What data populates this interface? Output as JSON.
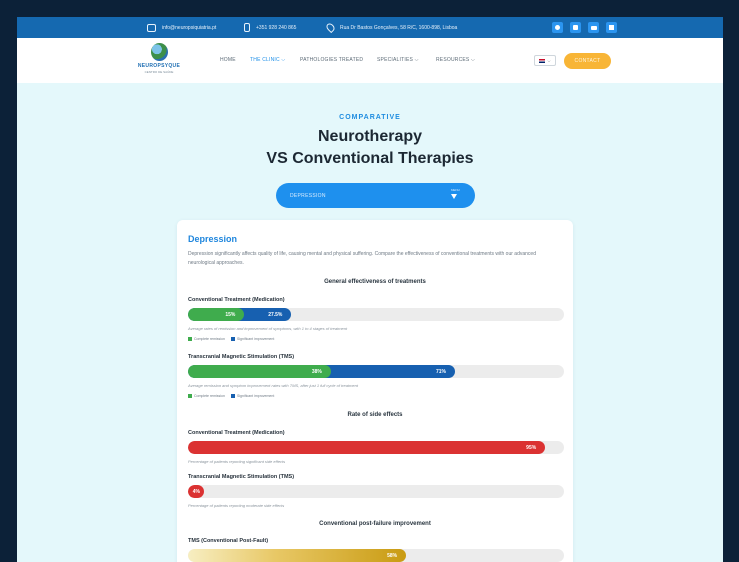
{
  "topbar": {
    "email": "info@neuropsiquiatria.pt",
    "phone": "+351 928 240 865",
    "address": "Rua Dr Bastos Gonçalves, 58 R/C, 1600-898, Lisboa",
    "social_icons": [
      "whatsapp-icon",
      "instagram-icon",
      "youtube-icon",
      "linkedin-icon"
    ]
  },
  "nav": {
    "logo_name": "NEUROPSYQUE",
    "logo_tagline": "CENTRO DE SAÚDE",
    "items": [
      {
        "label": "HOME"
      },
      {
        "label": "THE CLINIC ⌵"
      },
      {
        "label": "PATHOLOGIES TREATED"
      },
      {
        "label": "SPECIALITIES ⌵"
      },
      {
        "label": "RESOURCES ⌵"
      }
    ],
    "lang": "⌵",
    "contact": "CONTACT"
  },
  "hero": {
    "eyebrow": "COMPARATIVE",
    "title_line1": "Neurotherapy",
    "title_line2": "VS Conventional Therapies"
  },
  "selector": {
    "value": "DEPRESSION",
    "menu_label": "MENU"
  },
  "card": {
    "title": "Depression",
    "description": "Depression significantly affects quality of life, causing mental and physical suffering. Compare the effectiveness of conventional treatments with our advanced neurological approaches.",
    "legend_complete": "Complete remission",
    "legend_significant": "Significant improvement",
    "sections": {
      "effectiveness": "General effectiveness of treatments",
      "side_effects": "Rate of side effects",
      "post_failure": "Conventional post-failure improvement"
    },
    "conv_label": "Conventional Treatment (Medication)",
    "conv_remission": 15,
    "conv_remission_text": "15%",
    "conv_improvement": 27.5,
    "conv_improvement_text": "27.5%",
    "conv_note": "Average rates of remission and improvement of symptoms, with 1 to 4 stages of treatment",
    "tms_label": "Transcranial Magnetic Stimulation (TMS)",
    "tms_remission": 38,
    "tms_remission_text": "38%",
    "tms_improvement": 71,
    "tms_improvement_text": "71%",
    "tms_note": "Average remission and symptom improvement rates with TMS, after just 1 full cycle of treatment",
    "side_conv_label": "Conventional Treatment (Medication)",
    "side_conv": 95,
    "side_conv_text": "95%",
    "side_conv_note": "Percentage of patients reporting significant side effects",
    "side_tms_label": "Transcranial Magnetic Stimulation (TMS)",
    "side_tms": 4,
    "side_tms_text": "4%",
    "side_tms_note": "Percentage of patients reporting moderate side effects",
    "post_label": "TMS (Conventional Post-Fault)",
    "post_value": 58,
    "post_value_text": "58%"
  },
  "colors": {
    "accent_blue": "#1e90ee",
    "bar_blue": "#1760b0",
    "bar_green": "#3fac4d",
    "bar_red": "#db3232",
    "bar_gold": "#c99b12",
    "cta_orange": "#f8b536"
  }
}
